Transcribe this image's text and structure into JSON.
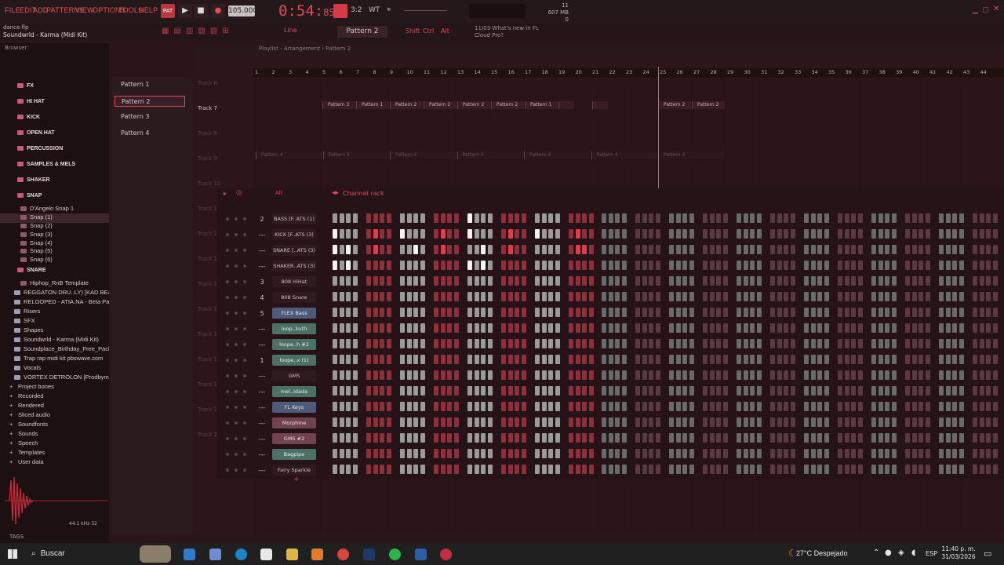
{
  "menu": [
    "FILE",
    "EDIT",
    "ADD",
    "PATTERNS",
    "VIEW",
    "OPTIONS",
    "TOOLS",
    "HELP"
  ],
  "bpm": "105.000",
  "time": {
    "main": "0:54:",
    "frac": "85"
  },
  "cpu": {
    "cores": "11",
    "mem": "607 MB",
    "poly": "0"
  },
  "project": {
    "file": "dance.flp",
    "title": "Soundwrld - Karma (Midi Kit)"
  },
  "toolbar2": {
    "mode": "Line",
    "pattern": "Pattern 2",
    "shift": "Shift",
    "ctrl": "Ctrl",
    "alt": "Alt",
    "news_line1": "11/03  What's new in FL",
    "news_line2": "Cloud Pro?"
  },
  "browser": {
    "title": "Browser",
    "rows": [
      {
        "label": "FX",
        "type": "cat"
      },
      {
        "label": "HI HAT",
        "type": "cat"
      },
      {
        "label": "KICK",
        "type": "cat"
      },
      {
        "label": "OPEN HAT",
        "type": "cat"
      },
      {
        "label": "PERCUSSION",
        "type": "cat"
      },
      {
        "label": "SAMPLES & MELS",
        "type": "cat"
      },
      {
        "label": "SHAKER",
        "type": "cat"
      },
      {
        "label": "SNAP",
        "type": "cat"
      },
      {
        "label": "D'Angelo Snap 1",
        "type": "file"
      },
      {
        "label": "Snap (1)",
        "type": "file-sel"
      },
      {
        "label": "Snap (2)",
        "type": "file"
      },
      {
        "label": "Snap (3)",
        "type": "file"
      },
      {
        "label": "Snap (4)",
        "type": "file"
      },
      {
        "label": "Snap (5)",
        "type": "file"
      },
      {
        "label": "Snap (6)",
        "type": "file"
      },
      {
        "label": "SNARE",
        "type": "cat"
      },
      {
        "label": "Hiphop_RnB Template",
        "type": "file"
      },
      {
        "label": "REGGATON DRU..LY) [KAD BEATS]",
        "type": "folder"
      },
      {
        "label": "RELOOPED - ATIA.NA - Beta Pack",
        "type": "folder"
      },
      {
        "label": "Risers",
        "type": "folder"
      },
      {
        "label": "SFX",
        "type": "folder"
      },
      {
        "label": "Shapes",
        "type": "folder"
      },
      {
        "label": "Soundwrld - Karma (Midi Kit)",
        "type": "folder"
      },
      {
        "label": "Soundplace_Birthday_Free_Pack",
        "type": "folder"
      },
      {
        "label": "Trap rap midi kit pbswave.com",
        "type": "folder"
      },
      {
        "label": "Vocals",
        "type": "folder"
      },
      {
        "label": "VORTEX DETROLON [Prodbymed]",
        "type": "folder"
      },
      {
        "label": "Project bones",
        "type": "plus"
      },
      {
        "label": "Recorded",
        "type": "plus"
      },
      {
        "label": "Rendered",
        "type": "plus"
      },
      {
        "label": "Sliced audio",
        "type": "plus"
      },
      {
        "label": "Soundfonts",
        "type": "plus"
      },
      {
        "label": "Sounds",
        "type": "plus"
      },
      {
        "label": "Speech",
        "type": "plus"
      },
      {
        "label": "Templates",
        "type": "plus"
      },
      {
        "label": "User data",
        "type": "plus"
      }
    ],
    "wave_info": "44.1 kHz 32",
    "tags": "TAGS"
  },
  "patterns": [
    "Pattern 1",
    "Pattern 2",
    "Pattern 3",
    "Pattern 4"
  ],
  "playlist": {
    "title": "Playlist - Arrangement › Pattern 2",
    "ruler": [
      "1",
      "2",
      "3",
      "4",
      "5",
      "6",
      "7",
      "8",
      "9",
      "10",
      "11",
      "12",
      "13",
      "14",
      "15",
      "16",
      "17",
      "18",
      "19",
      "20",
      "21",
      "22",
      "23",
      "24",
      "25",
      "26",
      "27",
      "28",
      "29",
      "30",
      "31",
      "32",
      "33",
      "34",
      "35",
      "36",
      "37",
      "38",
      "39",
      "40",
      "41",
      "42",
      "43",
      "44"
    ],
    "tracks": [
      "Track 6",
      "Track 7",
      "Track 8",
      "Track 9",
      "Track 10",
      "Track 11",
      "Track 12",
      "Track 13",
      "Track 14",
      "Track 15",
      "Track 16",
      "Track 17",
      "Track 18",
      "Track 19",
      "Track 20"
    ],
    "track7_clips": [
      "Pattern 3",
      "Pattern 1",
      "Pattern 2",
      "Pattern 2",
      "Pattern 2",
      "Pattern 2",
      "Pattern 1",
      "",
      "",
      "Pattern 2",
      "Pattern 2"
    ],
    "track9_clips": [
      "Pattern 4",
      "Pattern 4",
      "Pattern 4",
      "Pattern 4",
      "Pattern 4",
      "Pattern 4",
      "Pattern 4"
    ]
  },
  "rack": {
    "filter": "All",
    "title": "Channel rack",
    "channels": [
      {
        "num": "2",
        "name": "BASS [F..ATS (1)",
        "style": "dark",
        "steps": "W W W W R R R R W W W W R R R R O W W W R R R R W W W W R R R R"
      },
      {
        "num": "---",
        "name": "KICK [F..ATS (3)",
        "style": "dark",
        "steps": "O W W W R P R R O W W W R P R R O W W W R P R R O W W W R P R R"
      },
      {
        "num": "---",
        "name": "SNARE [..ATS (3)",
        "style": "dark",
        "steps": "O W O W R P R R W W O W R P R R W W O W R P R R W W W W R P P R"
      },
      {
        "num": "---",
        "name": "SHAKER..ATS (3)",
        "style": "dark",
        "steps": "O W O W R R R R W W W W R R R R O W O W R R R R W W W W R R R R"
      },
      {
        "num": "3",
        "name": "808 HiHat",
        "style": "dark",
        "steps": "W W W W R R R R W W W W R R R R W W W W R R R R W W W W R R R R"
      },
      {
        "num": "4",
        "name": "808 Snare",
        "style": "dark",
        "steps": "W W W W R R R R W W W W R R R R W W W W R R R R W W W W R R R R"
      },
      {
        "num": "5",
        "name": "FLEX Bass",
        "style": "blue",
        "steps": "W W W W R R R R W W W W R R R R W W W W R R R R W W W W R R R R"
      },
      {
        "num": "---",
        "name": "loop..kuth",
        "style": "green",
        "steps": "W W W W R R R R W W W W R R R R W W W W R R R R W W W W R R R R"
      },
      {
        "num": "---",
        "name": "loope..h #2",
        "style": "green",
        "steps": "W W W W R R R R W W W W R R R R W W W W R R R R W W W W R R R R"
      },
      {
        "num": "1",
        "name": "loope..x (1)",
        "style": "green",
        "steps": "W W W W R R R R W W W W R R R R W W W W R R R R W W W W R R R R"
      },
      {
        "num": "---",
        "name": "GMS",
        "style": "dark",
        "steps": "W W W W R R R R W W W W R R R R W W W W R R R R W W W W R R R R"
      },
      {
        "num": "---",
        "name": "mel..idada",
        "style": "green",
        "steps": "W W W W R R R R W W W W R R R R W W W W R R R R W W W W R R R R"
      },
      {
        "num": "---",
        "name": "FL Keys",
        "style": "blue",
        "steps": "W W W W R R R R W W W W R R R R W W W W R R R R W W W W R R R R"
      },
      {
        "num": "---",
        "name": "Morphine",
        "style": "pink",
        "steps": "W W W W R R R R W W W W R R R R W W W W R R R R W W W W R R R R"
      },
      {
        "num": "---",
        "name": "GMS #2",
        "style": "pink",
        "steps": "W W W W R R R R W W W W R R R R W W W W R R R R W W W W R R R R"
      },
      {
        "num": "---",
        "name": "Bagpipe",
        "style": "green",
        "steps": "W W W W R R R R W W W W R R R R W W W W R R R R W W W W R R R R"
      },
      {
        "num": "---",
        "name": "Fairy Sparkle",
        "style": "dark",
        "steps": "W W W W R R R R W W W W R R R R W W W W R R R R W W W W R R R R"
      }
    ]
  },
  "taskbar": {
    "search": "Buscar",
    "weather": "27°C  Despejado",
    "lang": "ESP",
    "time": "11:40 p. m.",
    "date": "31/03/2026"
  }
}
